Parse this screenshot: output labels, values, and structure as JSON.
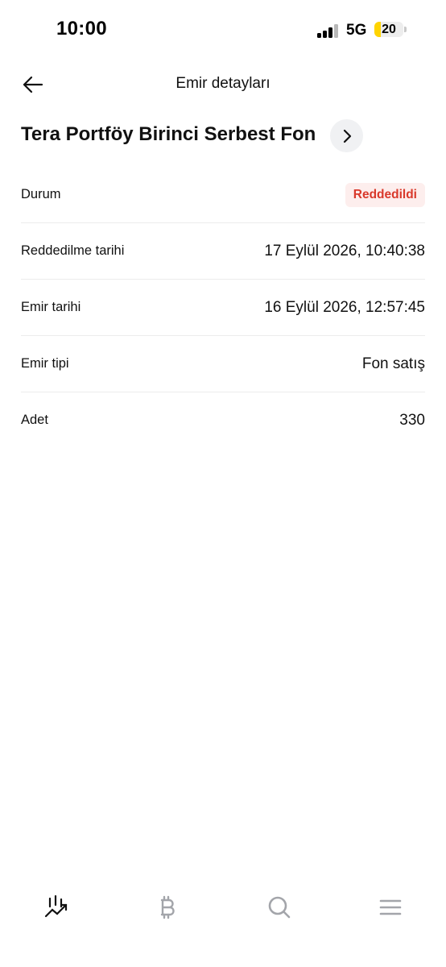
{
  "status_bar": {
    "time": "10:00",
    "network": "5G",
    "battery": "20",
    "battery_color": "#ffd400"
  },
  "header": {
    "title": "Emir detayları",
    "back_icon": "arrow-left-icon"
  },
  "fund": {
    "name": "Tera Portföy Birinci Serbest Fon",
    "chevron_icon": "chevron-right-icon"
  },
  "details": {
    "status": {
      "label": "Durum",
      "value": "Reddedildi",
      "value_color": "#d9392b"
    },
    "rejection_date": {
      "label": "Reddedilme tarihi",
      "value": "17 Eylül 2026, 10:40:38"
    },
    "order_date": {
      "label": "Emir tarihi",
      "value": "16 Eylül 2026, 12:57:45"
    },
    "order_type": {
      "label": "Emir tipi",
      "value": "Fon satış"
    },
    "quantity": {
      "label": "Adet",
      "value": "330"
    }
  },
  "bottom_nav": {
    "items": [
      "markets-chart-icon",
      "bitcoin-icon",
      "search-icon",
      "menu-icon"
    ],
    "active": "markets-chart-icon"
  }
}
